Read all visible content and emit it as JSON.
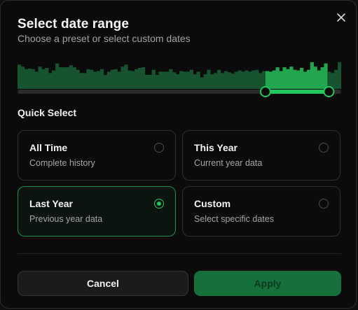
{
  "dialog": {
    "title": "Select date range",
    "subtitle": "Choose a preset or select custom dates"
  },
  "icons": {
    "close": "close-icon"
  },
  "histogram": {
    "bars": [
      38,
      35,
      31,
      32,
      31,
      27,
      35,
      31,
      33,
      25,
      29,
      40,
      34,
      34,
      34,
      37,
      34,
      30,
      25,
      25,
      31,
      30,
      27,
      28,
      31,
      22,
      27,
      30,
      31,
      27,
      35,
      38,
      29,
      28,
      31,
      33,
      34,
      22,
      22,
      30,
      22,
      27,
      27,
      27,
      31,
      26,
      23,
      28,
      27,
      27,
      30,
      23,
      27,
      18,
      23,
      30,
      23,
      25,
      30,
      25,
      28,
      26,
      24,
      27,
      29,
      27,
      29,
      27,
      29,
      30,
      25,
      28,
      28,
      27,
      29,
      34,
      28,
      34,
      31,
      35,
      30,
      29,
      33,
      27,
      30,
      42,
      35,
      29,
      34,
      40,
      27,
      25,
      30,
      42
    ],
    "selected_from_fraction": 0.766,
    "selected_to_fraction": 0.962,
    "colors": {
      "bar": "#16532e",
      "bar_selected": "#22a64e",
      "track": "#2a2a2d",
      "range": "#22c55e",
      "handle_fill": "#0b0b0c"
    }
  },
  "quick_select": {
    "label": "Quick Select",
    "options": [
      {
        "name": "All Time",
        "description": "Complete history",
        "selected": false
      },
      {
        "name": "This Year",
        "description": "Current year data",
        "selected": false
      },
      {
        "name": "Last Year",
        "description": "Previous year data",
        "selected": true
      },
      {
        "name": "Custom",
        "description": "Select specific dates",
        "selected": false
      }
    ]
  },
  "actions": {
    "cancel_label": "Cancel",
    "apply_label": "Apply"
  },
  "colors": {
    "accent": "#22c55e",
    "apply_bg": "#15703c",
    "apply_text": "#0b3a1d"
  }
}
